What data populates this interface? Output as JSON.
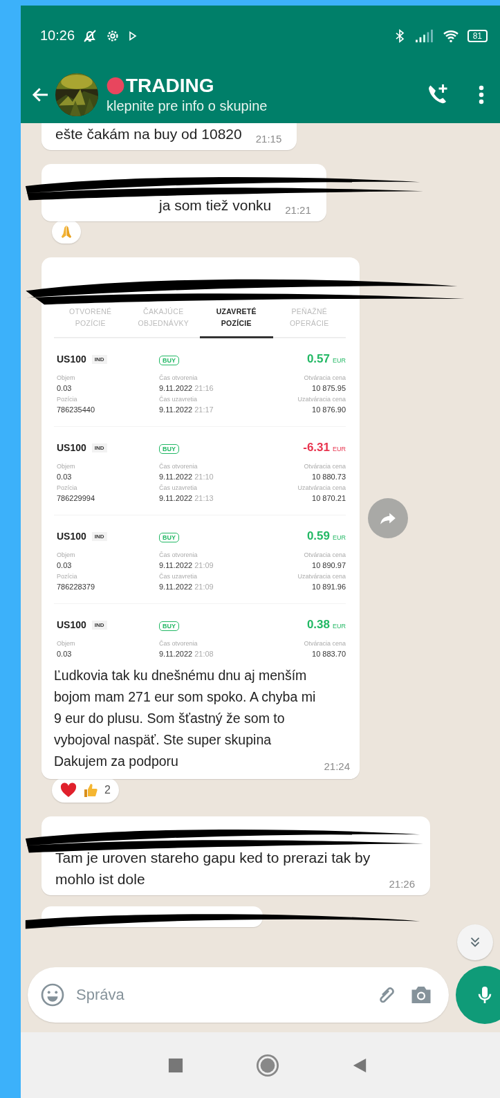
{
  "status_bar": {
    "time": "10:26",
    "battery": "81"
  },
  "chat_header": {
    "title": "TRADING",
    "subtitle": "klepnite pre info o skupine"
  },
  "messages": [
    {
      "kind": "text",
      "text": "ešte čakám na buy od 10820",
      "time": "21:15",
      "redacted": false
    },
    {
      "kind": "text",
      "text": "ja som tiež vonku",
      "time": "21:21",
      "redacted": true,
      "reactions": {
        "items": [
          {
            "kind": "praying_hands"
          }
        ]
      }
    },
    {
      "redacted": true,
      "time": "21:24",
      "caption": "Ľudkovia tak ku dnešnému dnu aj menším bojom mam 271 eur som spoko. A chyba mi 9 eur do plusu. Som šťastný že som to vybojoval naspäť. Ste super skupina Dakujem za podporu",
      "reactions": {
        "items": [
          {
            "kind": "heart"
          },
          {
            "kind": "thumbs_up"
          }
        ],
        "count": "2"
      },
      "screenshot": {
        "tabs": [
          {
            "lines": [
              "OTVORENÉ",
              "POZÍCIE"
            ],
            "selected": false
          },
          {
            "lines": [
              "ČAKAJÚCE",
              "OBJEDNÁVKY"
            ],
            "selected": false
          },
          {
            "lines": [
              "UZAVRETÉ",
              "POZÍCIE"
            ],
            "selected": true
          },
          {
            "lines": [
              "PEŇAŽNÉ",
              "OPERÁCIE"
            ],
            "selected": false
          }
        ],
        "trades": [
          {
            "symbol": "US100",
            "market": "IND",
            "side": "BUY",
            "pnl": "0.57",
            "currency": "EUR",
            "color": "#22b864",
            "rows": [
              [
                {
                  "label": "Objem",
                  "value": "0.03"
                },
                {
                  "label": "Čas otvorenia",
                  "value": "9.11.2022",
                  "time": "21:16"
                },
                {
                  "label": "Otváracia cena",
                  "value": "10 875.95"
                }
              ],
              [
                {
                  "label": "Pozícia",
                  "value": "786235440"
                },
                {
                  "label": "Čas uzavretia",
                  "value": "9.11.2022",
                  "time": "21:17"
                },
                {
                  "label": "Uzatváracia cena",
                  "value": "10 876.90"
                }
              ]
            ]
          },
          {
            "symbol": "US100",
            "market": "IND",
            "side": "BUY",
            "pnl": "-6.31",
            "currency": "EUR",
            "color": "#e8344e",
            "rows": [
              [
                {
                  "label": "Objem",
                  "value": "0.03"
                },
                {
                  "label": "Čas otvorenia",
                  "value": "9.11.2022",
                  "time": "21:10"
                },
                {
                  "label": "Otváracia cena",
                  "value": "10 880.73"
                }
              ],
              [
                {
                  "label": "Pozícia",
                  "value": "786229994"
                },
                {
                  "label": "Čas uzavretia",
                  "value": "9.11.2022",
                  "time": "21:13"
                },
                {
                  "label": "Uzatváracia cena",
                  "value": "10 870.21"
                }
              ]
            ]
          },
          {
            "symbol": "US100",
            "market": "IND",
            "side": "BUY",
            "pnl": "0.59",
            "currency": "EUR",
            "color": "#22b864",
            "rows": [
              [
                {
                  "label": "Objem",
                  "value": "0.03"
                },
                {
                  "label": "Čas otvorenia",
                  "value": "9.11.2022",
                  "time": "21:09"
                },
                {
                  "label": "Otváracia cena",
                  "value": "10 890.97"
                }
              ],
              [
                {
                  "label": "Pozícia",
                  "value": "786228379"
                },
                {
                  "label": "Čas uzavretia",
                  "value": "9.11.2022",
                  "time": "21:09"
                },
                {
                  "label": "Uzatváracia cena",
                  "value": "10 891.96"
                }
              ]
            ]
          },
          {
            "symbol": "US100",
            "market": "IND",
            "side": "BUY",
            "pnl": "0.38",
            "currency": "EUR",
            "color": "#22b864",
            "rows": [
              [
                {
                  "label": "Objem",
                  "value": "0.03"
                },
                {
                  "label": "Čas otvorenia",
                  "value": "9.11.2022",
                  "time": "21:08"
                },
                {
                  "label": "Otváracia cena",
                  "value": "10 883.70"
                }
              ]
            ]
          }
        ]
      }
    },
    {
      "kind": "text",
      "text": "Tam je uroven stareho gapu ked to prerazi tak by mohlo ist dole",
      "time": "21:26",
      "redacted": true
    },
    {
      "kind": "partial",
      "redacted": true
    }
  ],
  "composer": {
    "placeholder": "Správa"
  }
}
